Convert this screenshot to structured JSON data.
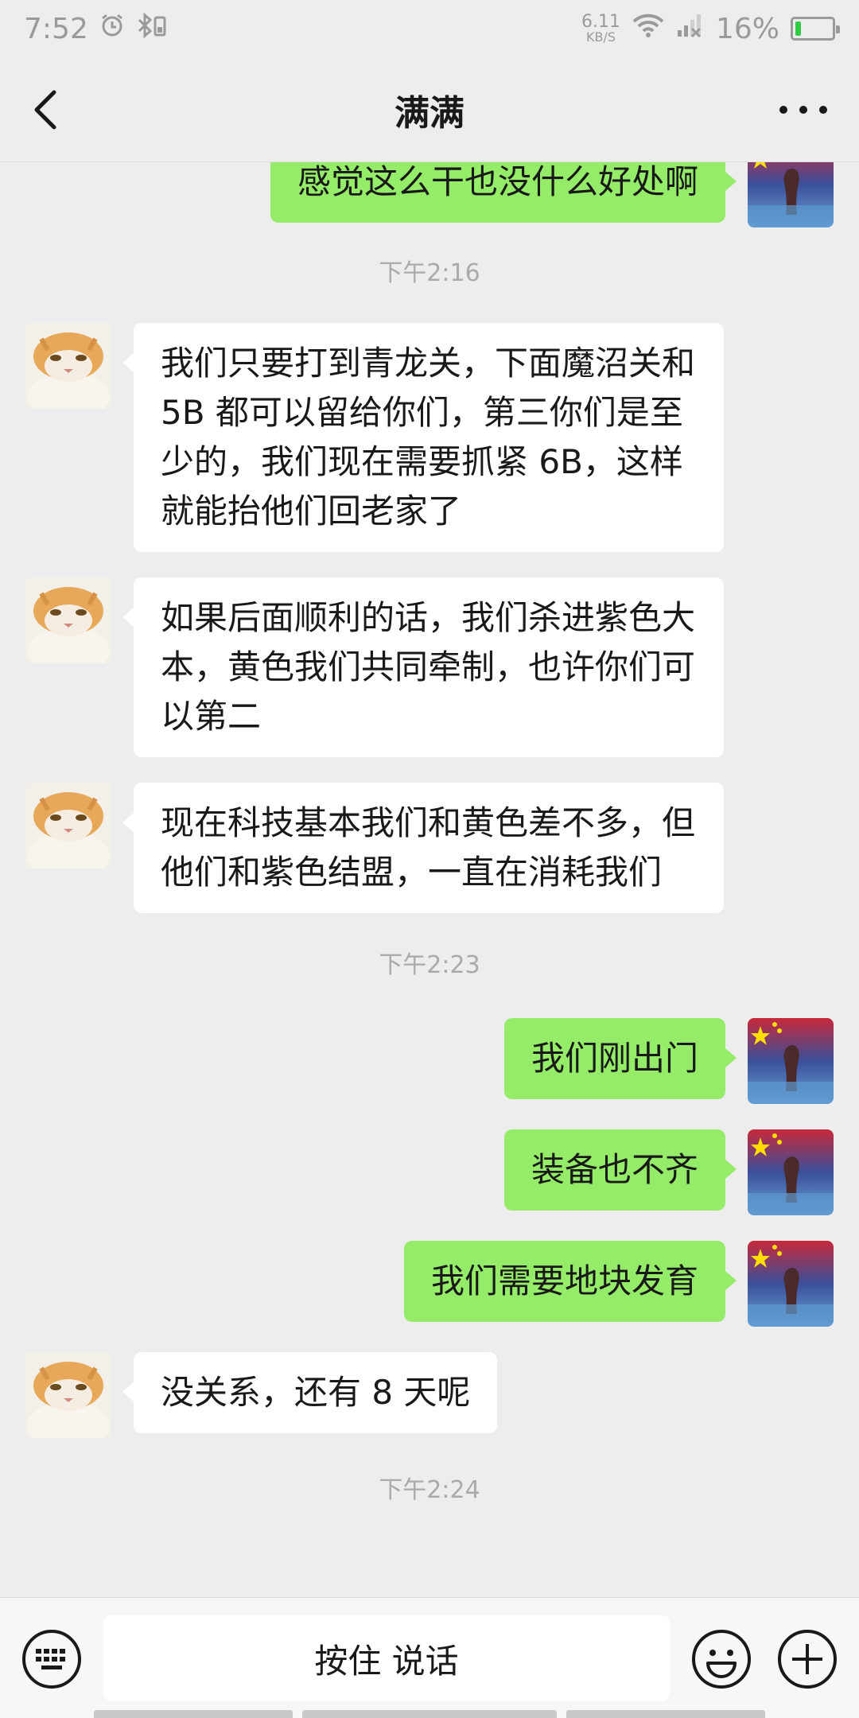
{
  "status_bar": {
    "time": "7:52",
    "net_speed": "6.11",
    "net_unit": "KB/S",
    "battery": "16%",
    "battery_level": 0.16
  },
  "header": {
    "title": "满满"
  },
  "chat": {
    "top_message": "感觉这么干也没什么好处啊",
    "time_1": "下午2:16",
    "msg_1": "我们只要打到青龙关，下面魔沼关和 5B 都可以留给你们，第三你们是至少的，我们现在需要抓紧 6B，这样就能抬他们回老家了",
    "msg_2": "如果后面顺利的话，我们杀进紫色大本，黄色我们共同牵制，也许你们可以第二",
    "msg_3": "现在科技基本我们和黄色差不多，但他们和紫色结盟，一直在消耗我们",
    "time_2": "下午2:23",
    "msg_4": "我们刚出门",
    "msg_5": "装备也不齐",
    "msg_6": "我们需要地块发育",
    "msg_7": "没关系，还有 8 天呢",
    "time_3": "下午2:24"
  },
  "input_bar": {
    "talk_label": "按住 说话"
  },
  "colors": {
    "sent_bubble": "#95ec69",
    "received_bubble": "#ffffff",
    "background": "#ededed"
  },
  "icons": {
    "alarm": "alarm-icon",
    "bluetooth": "bluetooth-icon",
    "wifi": "wifi-icon",
    "signal": "signal-icon",
    "back": "back-icon",
    "more": "more-icon",
    "keyboard": "keyboard-icon",
    "emoji": "emoji-icon",
    "plus": "plus-icon"
  }
}
